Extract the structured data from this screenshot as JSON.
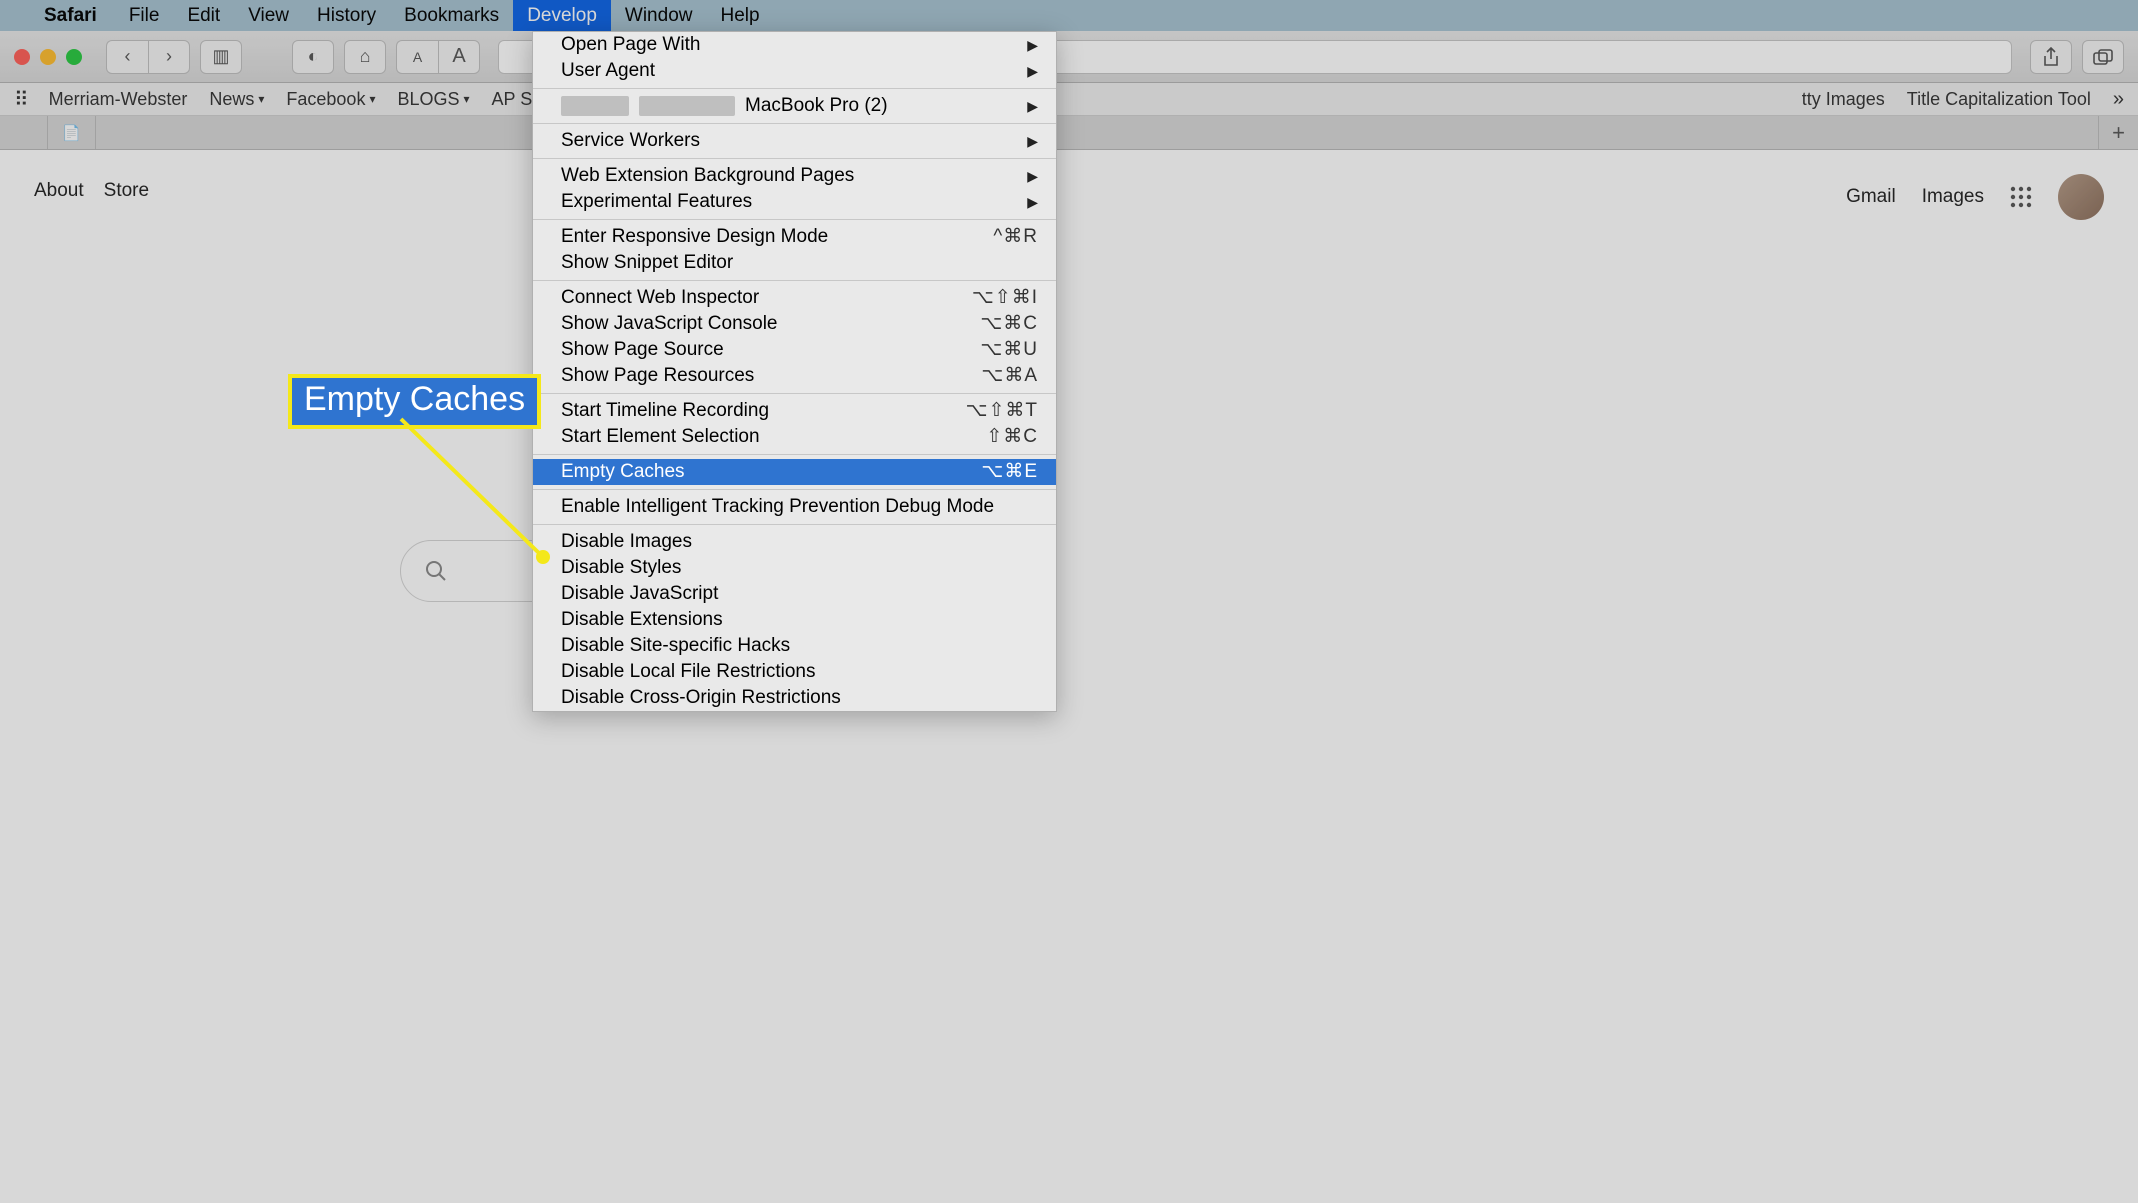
{
  "menubar": {
    "app_name": "Safari",
    "items": [
      "File",
      "Edit",
      "View",
      "History",
      "Bookmarks",
      "Develop",
      "Window",
      "Help"
    ],
    "active_index": 5
  },
  "toolbar": {
    "icons": {
      "back": "‹",
      "forward": "›",
      "sidebar": "▥",
      "privacy": "◐",
      "home": "⌂",
      "text_small": "A",
      "text_large": "A",
      "share": "⇪",
      "tabs": "⧉"
    }
  },
  "favorites": {
    "grid_icon": "⠿",
    "items": [
      {
        "label": "Merriam-Webster",
        "chevron": false
      },
      {
        "label": "News",
        "chevron": true
      },
      {
        "label": "Facebook",
        "chevron": true
      },
      {
        "label": "BLOGS",
        "chevron": true
      },
      {
        "label": "AP Sty",
        "chevron": false
      }
    ],
    "right_items": [
      {
        "label": "tty Images"
      },
      {
        "label": "Title Capitalization Tool"
      }
    ],
    "overflow": "»"
  },
  "tabs": {
    "apple_icon": "",
    "page_icon": "📄",
    "new_tab": "+"
  },
  "page": {
    "left_links": [
      "About",
      "Store"
    ],
    "right_links": [
      "Gmail",
      "Images"
    ],
    "search_icon": "🔍"
  },
  "dropdown": {
    "groups": [
      [
        {
          "label": "Open Page With",
          "arrow": true
        },
        {
          "label": "User Agent",
          "arrow": true
        }
      ],
      [
        {
          "label": "MacBook Pro (2)",
          "arrow": true,
          "machine": true
        }
      ],
      [
        {
          "label": "Service Workers",
          "arrow": true
        }
      ],
      [
        {
          "label": "Web Extension Background Pages",
          "arrow": true
        },
        {
          "label": "Experimental Features",
          "arrow": true
        }
      ],
      [
        {
          "label": "Enter Responsive Design Mode",
          "shortcut": "^⌘R"
        },
        {
          "label": "Show Snippet Editor"
        }
      ],
      [
        {
          "label": "Connect Web Inspector",
          "shortcut": "⌥⇧⌘I"
        },
        {
          "label": "Show JavaScript Console",
          "shortcut": "⌥⌘C"
        },
        {
          "label": "Show Page Source",
          "shortcut": "⌥⌘U"
        },
        {
          "label": "Show Page Resources",
          "shortcut": "⌥⌘A"
        }
      ],
      [
        {
          "label": "Start Timeline Recording",
          "shortcut": "⌥⇧⌘T"
        },
        {
          "label": "Start Element Selection",
          "shortcut": "⇧⌘C"
        }
      ],
      [
        {
          "label": "Empty Caches",
          "shortcut": "⌥⌘E",
          "highlight": true
        }
      ],
      [
        {
          "label": "Enable Intelligent Tracking Prevention Debug Mode"
        }
      ],
      [
        {
          "label": "Disable Images"
        },
        {
          "label": "Disable Styles"
        },
        {
          "label": "Disable JavaScript"
        },
        {
          "label": "Disable Extensions"
        },
        {
          "label": "Disable Site-specific Hacks"
        },
        {
          "label": "Disable Local File Restrictions"
        },
        {
          "label": "Disable Cross-Origin Restrictions"
        }
      ]
    ]
  },
  "callout": {
    "text": "Empty Caches"
  }
}
